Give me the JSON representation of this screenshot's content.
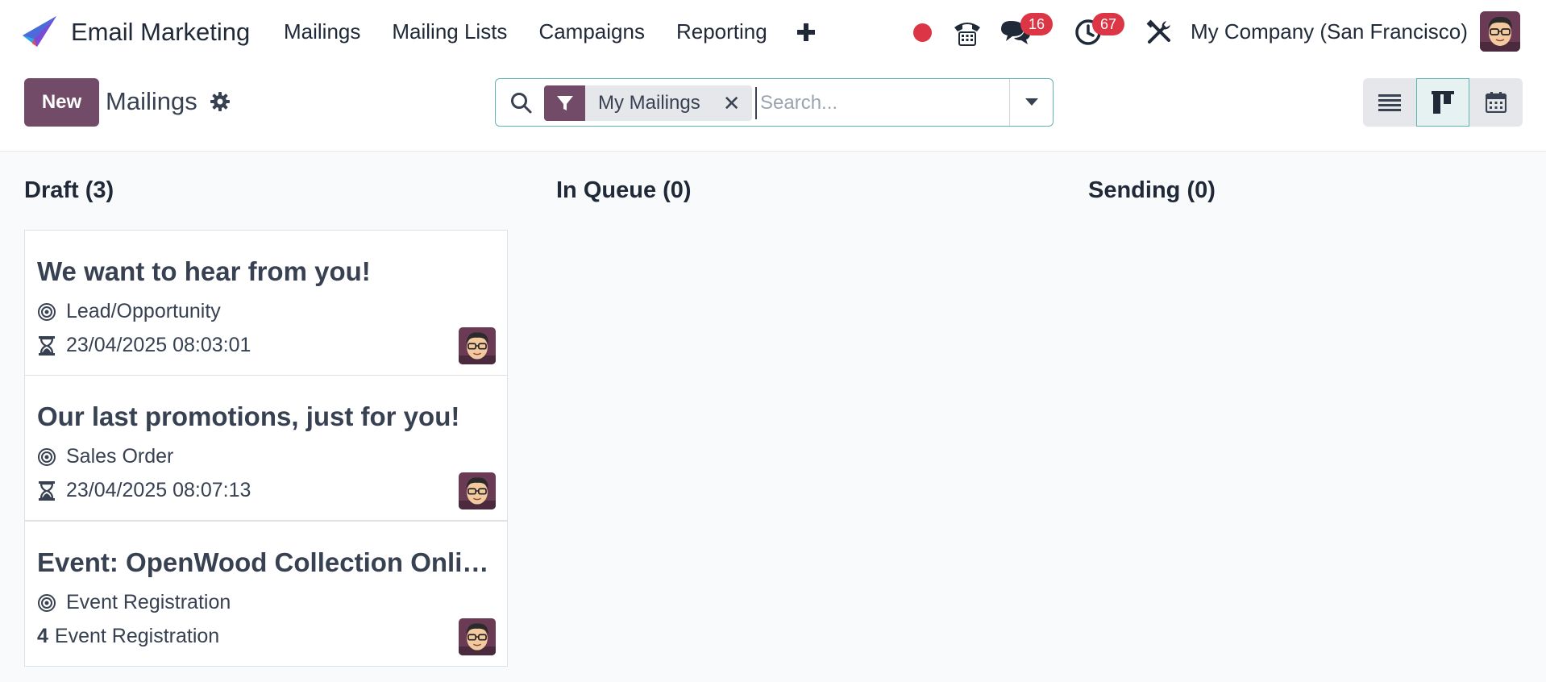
{
  "app": {
    "title": "Email Marketing",
    "brand_color": "#714b67",
    "logo_icon": "paper-plane-logo"
  },
  "nav": {
    "items": [
      {
        "label": "Mailings"
      },
      {
        "label": "Mailing Lists"
      },
      {
        "label": "Campaigns"
      },
      {
        "label": "Reporting"
      }
    ],
    "add_icon": "plus-icon"
  },
  "systray": {
    "messages_badge": "16",
    "activities_badge": "67",
    "company": "My Company (San Francisco)",
    "badge_color": "#dc3545"
  },
  "control": {
    "new_label": "New",
    "breadcrumb": "Mailings",
    "search": {
      "facet_label": "My Mailings",
      "facet_remove": "✕",
      "placeholder": "Search..."
    },
    "views": [
      "list",
      "kanban",
      "calendar"
    ],
    "active_view": "kanban"
  },
  "columns": [
    {
      "title": "Draft (3)"
    },
    {
      "title": "In Queue (0)"
    },
    {
      "title": "Sending (0)"
    }
  ],
  "cards": [
    {
      "title": "We want to hear from you!",
      "target": "Lead/Opportunity",
      "date": "23/04/2025 08:03:01"
    },
    {
      "title": "Our last promotions, just for you!",
      "target": "Sales Order",
      "date": "23/04/2025 08:07:13"
    },
    {
      "title": "Event: OpenWood Collection Online Reveal",
      "target": "Event Registration",
      "count": "4",
      "count_label": "Event Registration"
    }
  ]
}
